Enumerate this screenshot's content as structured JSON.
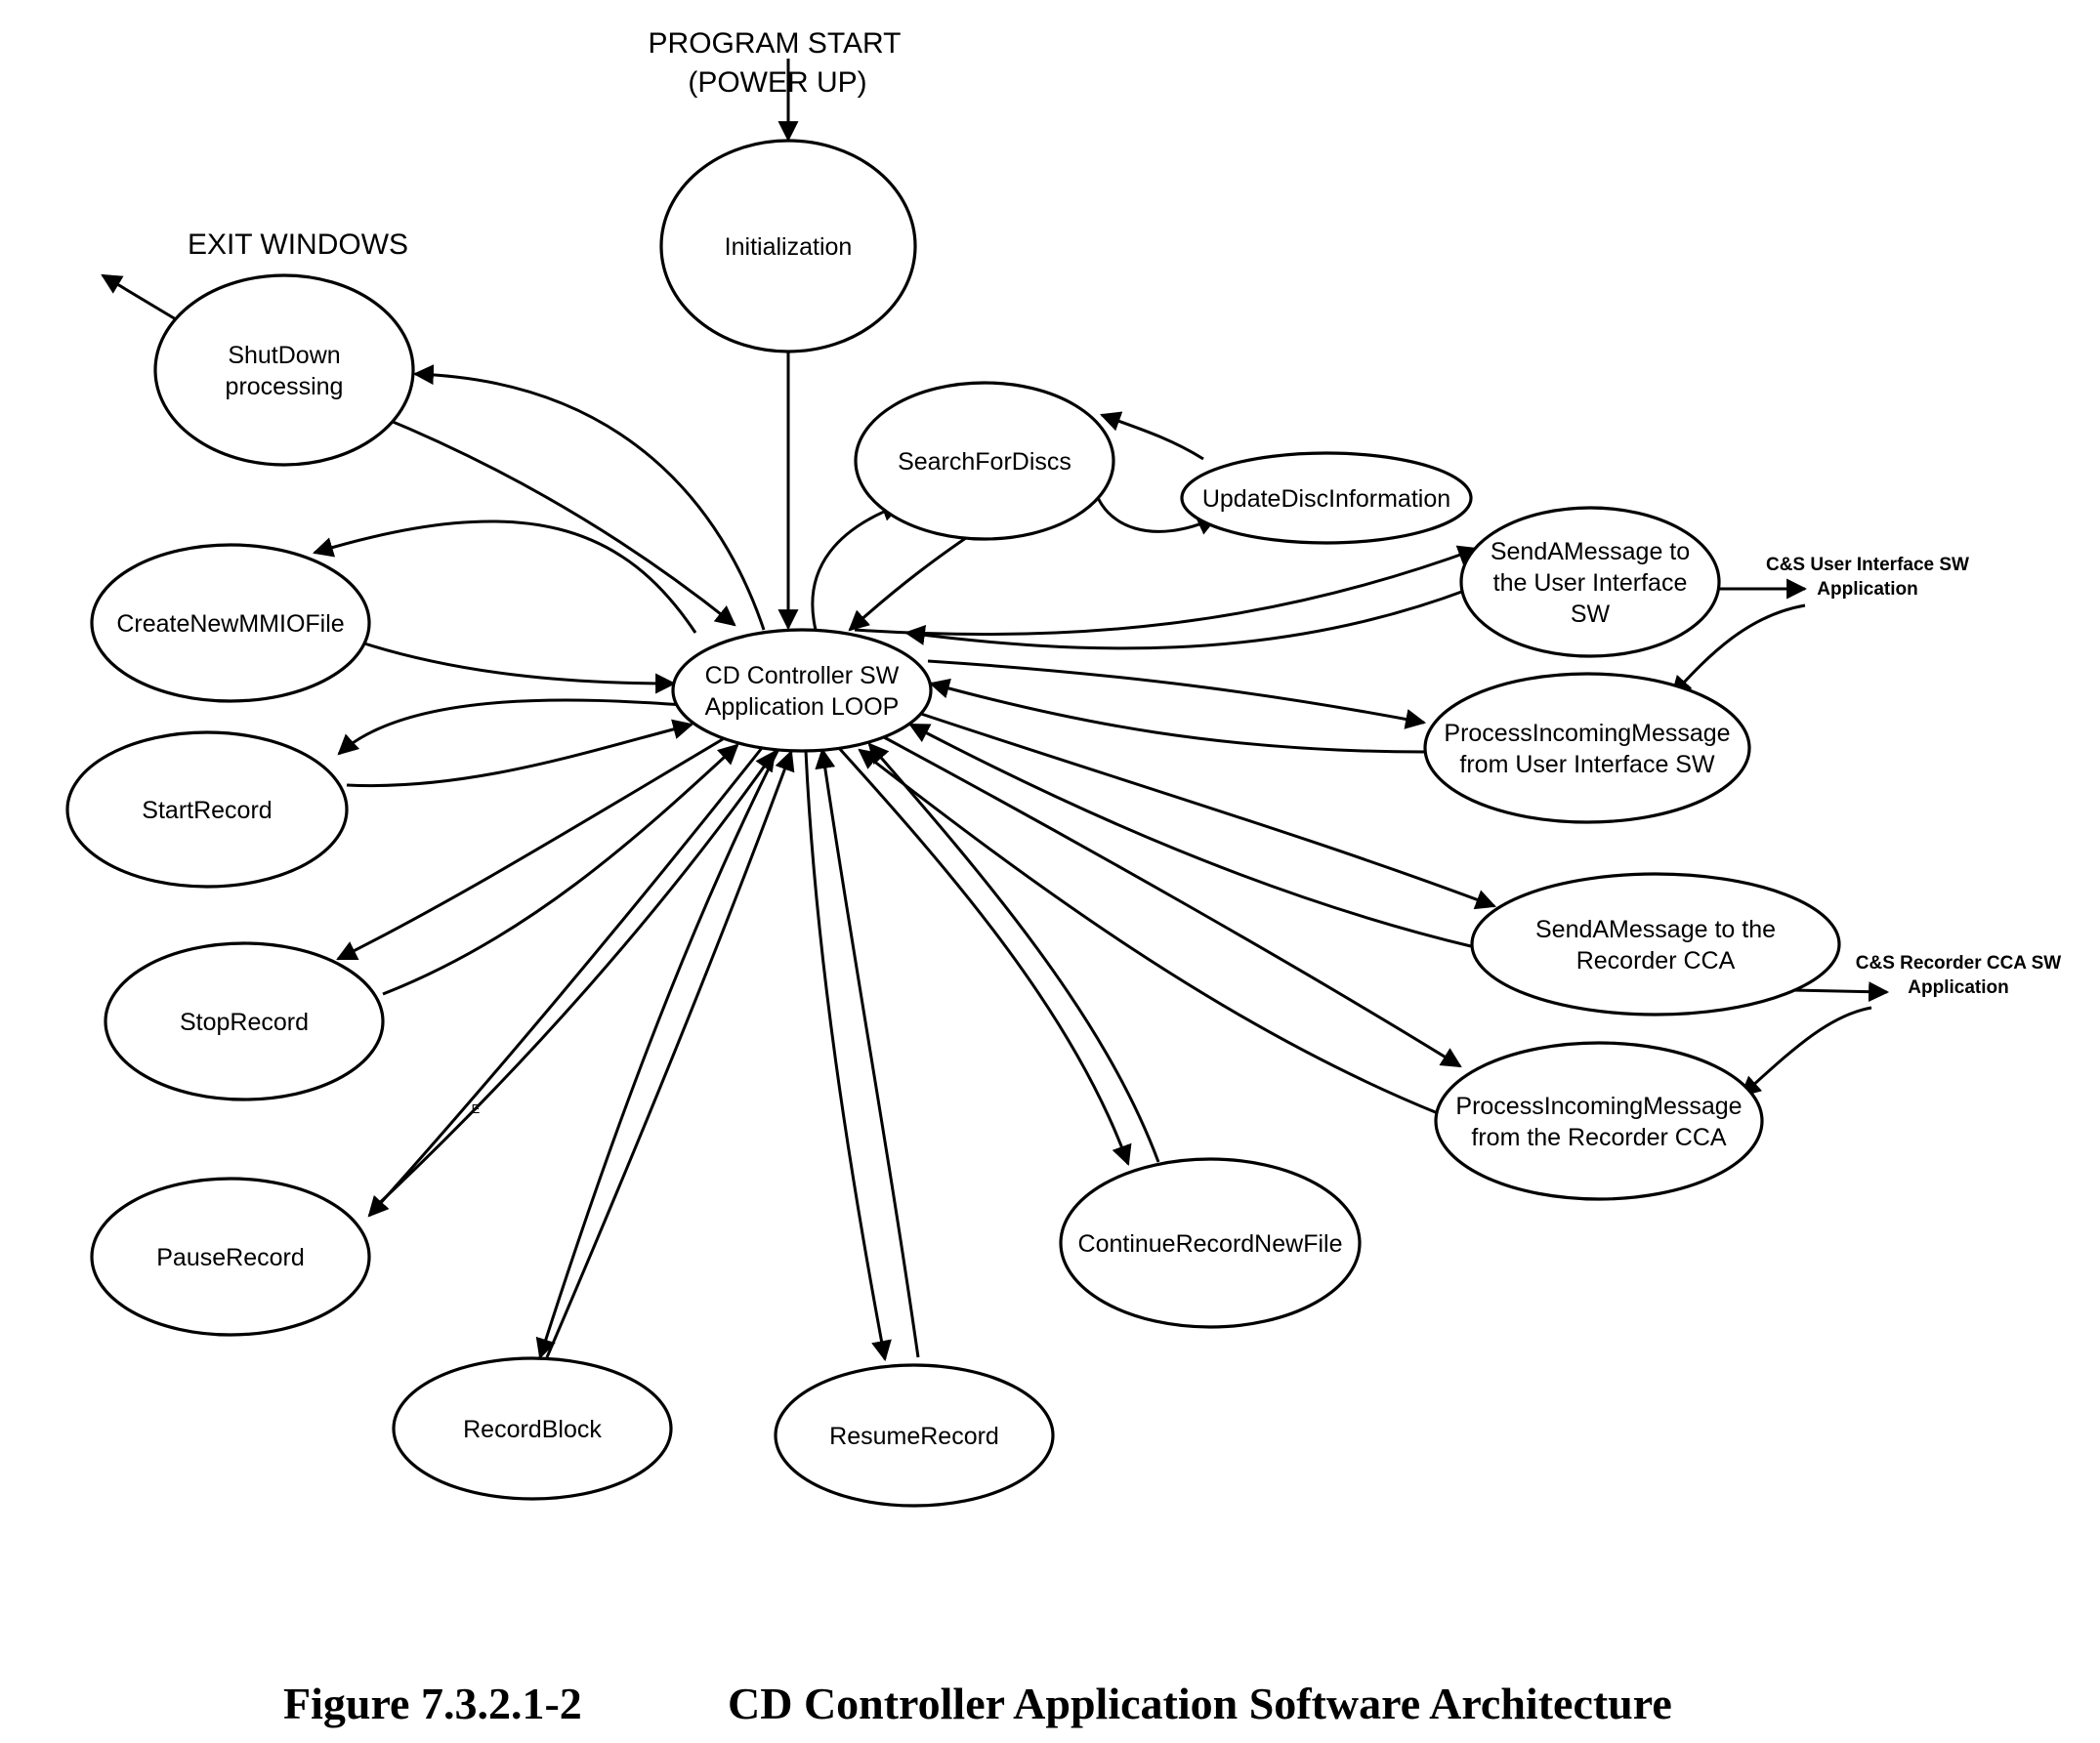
{
  "diagram": {
    "start_label": [
      "PROGRAM START",
      "(POWER UP)"
    ],
    "exit_label": "EXIT WINDOWS",
    "stray_mark": "E",
    "nodes": {
      "initialization": [
        "Initialization"
      ],
      "shutdown": [
        "ShutDown",
        "processing"
      ],
      "search_for_discs": [
        "SearchForDiscs"
      ],
      "update_disc_info": [
        "UpdateDiscInformation"
      ],
      "send_msg_ui": [
        "SendAMessage to",
        "the User Interface",
        "SW"
      ],
      "create_mmio": [
        "CreateNewMMIOFile"
      ],
      "center_loop": [
        "CD Controller SW",
        "Application LOOP"
      ],
      "process_msg_ui": [
        "ProcessIncomingMessage",
        "from User Interface SW"
      ],
      "start_record": [
        "StartRecord"
      ],
      "send_msg_recorder": [
        "SendAMessage to the",
        "Recorder CCA"
      ],
      "stop_record": [
        "StopRecord"
      ],
      "process_msg_recorder": [
        "ProcessIncomingMessage",
        "from the Recorder CCA"
      ],
      "pause_record": [
        "PauseRecord"
      ],
      "continue_record_new_file": [
        "ContinueRecordNewFile"
      ],
      "record_block": [
        "RecordBlock"
      ],
      "resume_record": [
        "ResumeRecord"
      ]
    },
    "external": {
      "ui_app": [
        "C&S User Interface SW",
        "Application"
      ],
      "recorder_app": [
        "C&S Recorder CCA SW",
        "Application"
      ]
    },
    "edges": [
      {
        "from": "program_start",
        "to": "initialization"
      },
      {
        "from": "initialization",
        "to": "center_loop"
      },
      {
        "from": "center_loop",
        "to": "shutdown"
      },
      {
        "from": "shutdown",
        "to": "center_loop"
      },
      {
        "from": "shutdown",
        "to": "exit_windows"
      },
      {
        "from": "center_loop",
        "to": "create_mmio"
      },
      {
        "from": "create_mmio",
        "to": "center_loop"
      },
      {
        "from": "center_loop",
        "to": "start_record"
      },
      {
        "from": "start_record",
        "to": "center_loop"
      },
      {
        "from": "center_loop",
        "to": "stop_record"
      },
      {
        "from": "stop_record",
        "to": "center_loop"
      },
      {
        "from": "center_loop",
        "to": "pause_record"
      },
      {
        "from": "pause_record",
        "to": "center_loop"
      },
      {
        "from": "center_loop",
        "to": "record_block"
      },
      {
        "from": "record_block",
        "to": "center_loop"
      },
      {
        "from": "center_loop",
        "to": "resume_record"
      },
      {
        "from": "resume_record",
        "to": "center_loop"
      },
      {
        "from": "center_loop",
        "to": "continue_record_new_file"
      },
      {
        "from": "continue_record_new_file",
        "to": "center_loop"
      },
      {
        "from": "center_loop",
        "to": "search_for_discs"
      },
      {
        "from": "search_for_discs",
        "to": "center_loop"
      },
      {
        "from": "search_for_discs",
        "to": "update_disc_info"
      },
      {
        "from": "update_disc_info",
        "to": "search_for_discs"
      },
      {
        "from": "center_loop",
        "to": "send_msg_ui"
      },
      {
        "from": "send_msg_ui",
        "to": "center_loop"
      },
      {
        "from": "send_msg_ui",
        "to": "ui_app"
      },
      {
        "from": "ui_app",
        "to": "process_msg_ui"
      },
      {
        "from": "center_loop",
        "to": "process_msg_ui"
      },
      {
        "from": "process_msg_ui",
        "to": "center_loop"
      },
      {
        "from": "center_loop",
        "to": "send_msg_recorder"
      },
      {
        "from": "send_msg_recorder",
        "to": "center_loop"
      },
      {
        "from": "send_msg_recorder",
        "to": "recorder_app"
      },
      {
        "from": "recorder_app",
        "to": "process_msg_recorder"
      },
      {
        "from": "center_loop",
        "to": "process_msg_recorder"
      },
      {
        "from": "process_msg_recorder",
        "to": "center_loop"
      }
    ]
  },
  "caption": {
    "figure_number": "Figure 7.3.2.1-2",
    "title": "CD Controller Application Software Architecture"
  }
}
